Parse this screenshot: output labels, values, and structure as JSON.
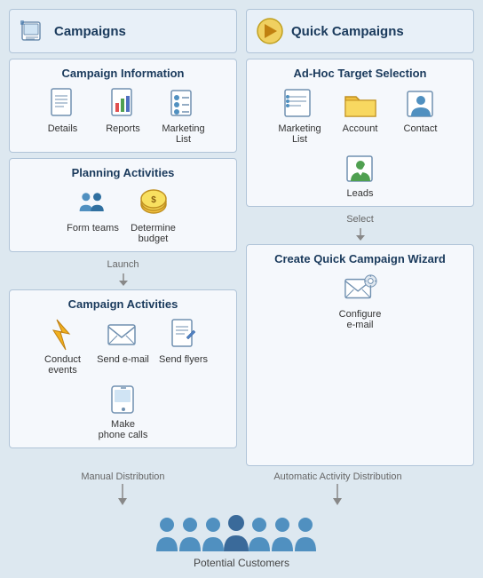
{
  "left_column": {
    "header_title": "Campaigns",
    "boxes": [
      {
        "id": "campaign-info",
        "title": "Campaign Information",
        "items": [
          {
            "id": "details",
            "label": "Details",
            "icon": "document"
          },
          {
            "id": "reports",
            "label": "Reports",
            "icon": "report"
          },
          {
            "id": "marketing-list",
            "label": "Marketing List",
            "icon": "marketing-list"
          }
        ]
      },
      {
        "id": "planning",
        "title": "Planning Activities",
        "items": [
          {
            "id": "form-teams",
            "label": "Form teams",
            "icon": "teams"
          },
          {
            "id": "determine-budget",
            "label": "Determine budget",
            "icon": "budget"
          }
        ]
      },
      {
        "id": "campaign-activities",
        "title": "Campaign Activities",
        "items": [
          {
            "id": "conduct-events",
            "label": "Conduct events",
            "icon": "lightning"
          },
          {
            "id": "send-email",
            "label": "Send e-mail",
            "icon": "email"
          },
          {
            "id": "send-flyers",
            "label": "Send flyers",
            "icon": "flyers"
          },
          {
            "id": "make-calls",
            "label": "Make phone calls",
            "icon": "phone"
          }
        ]
      }
    ],
    "arrow_label": "Launch"
  },
  "right_column": {
    "header_title": "Quick Campaigns",
    "boxes": [
      {
        "id": "adhoc",
        "title": "Ad-Hoc Target Selection",
        "items": [
          {
            "id": "marketing-list-r",
            "label": "Marketing List",
            "icon": "marketing-list"
          },
          {
            "id": "account",
            "label": "Account",
            "icon": "account"
          },
          {
            "id": "contact",
            "label": "Contact",
            "icon": "contact"
          },
          {
            "id": "leads",
            "label": "Leads",
            "icon": "leads"
          }
        ]
      },
      {
        "id": "wizard",
        "title": "Create Quick Campaign Wizard",
        "items": [
          {
            "id": "configure-email",
            "label": "Configure e-mail",
            "icon": "configure-email"
          }
        ]
      }
    ],
    "arrow_label": "Select"
  },
  "bottom": {
    "left_label": "Manual Distribution",
    "right_label": "Automatic Activity Distribution",
    "customers_label": "Potential Customers"
  }
}
